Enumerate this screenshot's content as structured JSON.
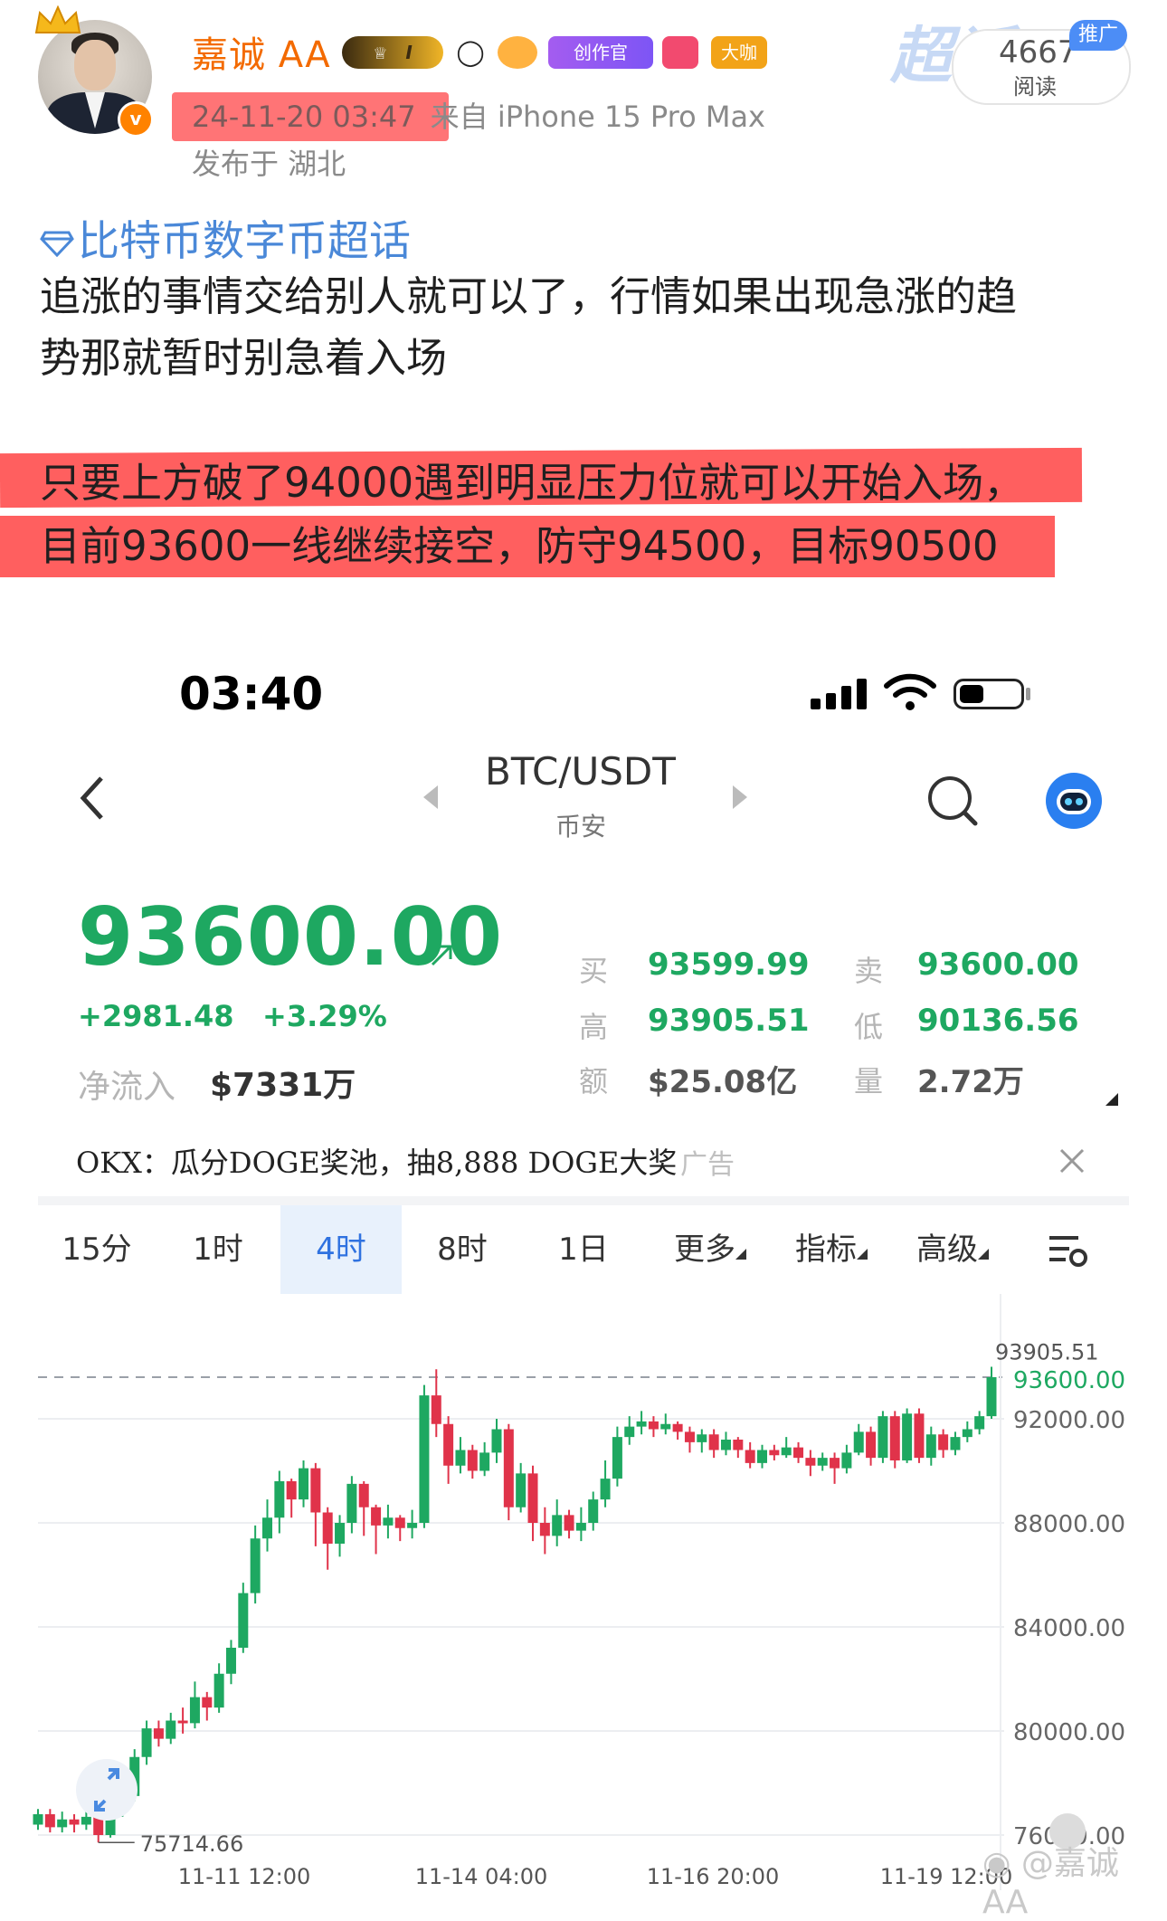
{
  "post": {
    "username": "嘉诚 AA",
    "timestamp": "24-11-20 03:47",
    "source": "来自 iPhone 15 Pro Max",
    "location": "发布于 湖北",
    "read_count": "4667",
    "read_label": "阅读",
    "promo_badge": "推广",
    "badge_creator": "创作官",
    "badge_daka": "大咖",
    "level_badge": "I",
    "verified_mark": "v",
    "super_topic_mark": "超话",
    "topic": "比特币数字币超话",
    "paragraph1_line1": "追涨的事情交给别人就可以了，行情如果出现急涨的趋",
    "paragraph1_line2": "势那就暂时别急着入场",
    "paragraph2_line1": "只要上方破了94000遇到明显压力位就可以开始入场，",
    "paragraph2_line2": "目前93600一线继续接空，防守94500，目标90500"
  },
  "screenshot": {
    "status_time": "03:40",
    "pair": "BTC/USDT",
    "exchange": "币安",
    "price": "93600.00",
    "change_abs": "+2981.48",
    "change_pct": "+3.29%",
    "netflow_label": "净流入",
    "netflow_value": "$7331万",
    "stats": {
      "buy_label": "买",
      "buy_value": "93599.99",
      "sell_label": "卖",
      "sell_value": "93600.00",
      "high_label": "高",
      "high_value": "93905.51",
      "low_label": "低",
      "low_value": "90136.56",
      "amount_label": "额",
      "amount_value": "$25.08亿",
      "volume_label": "量",
      "volume_value": "2.72万"
    },
    "ad_text": "OKX：瓜分DOGE奖池，抽8,888 DOGE大奖",
    "ad_tag": "广告",
    "tabs": [
      "15分",
      "1时",
      "4时",
      "8时",
      "1日",
      "更多",
      "指标",
      "高级"
    ],
    "active_tab": "4时"
  },
  "chart_data": {
    "type": "candlestick",
    "price_labels": [
      "93600.00",
      "92000.00",
      "88000.00",
      "84000.00",
      "80000.00",
      "76000.00"
    ],
    "current_price": 93600.0,
    "high_marker": "93905.51",
    "low_marker": "75714.66",
    "x_labels": [
      "11-11 12:00",
      "11-14 04:00",
      "11-16 20:00",
      "11-19 12:00"
    ],
    "ylim": [
      75000,
      95500
    ],
    "up_color": "#1ea861",
    "down_color": "#e0334a",
    "candles": [
      [
        76400,
        76800,
        77000,
        76200
      ],
      [
        76800,
        76300,
        77000,
        76100
      ],
      [
        76300,
        76600,
        76900,
        76100
      ],
      [
        76600,
        76400,
        76800,
        76100
      ],
      [
        76400,
        76700,
        76900,
        76200
      ],
      [
        76700,
        76000,
        76800,
        75714.66
      ],
      [
        76000,
        76900,
        77100,
        75900
      ],
      [
        76900,
        77500,
        77800,
        76700
      ],
      [
        77500,
        79000,
        79300,
        77300
      ],
      [
        79000,
        80100,
        80400,
        78700
      ],
      [
        80100,
        79700,
        80400,
        79400
      ],
      [
        79700,
        80400,
        80700,
        79500
      ],
      [
        80400,
        80300,
        80900,
        79900
      ],
      [
        80300,
        81300,
        81900,
        80100
      ],
      [
        81300,
        80900,
        81500,
        80400
      ],
      [
        80900,
        82200,
        82600,
        80700
      ],
      [
        82200,
        83200,
        83500,
        81800
      ],
      [
        83200,
        85300,
        85700,
        83000
      ],
      [
        85300,
        87400,
        87900,
        84900
      ],
      [
        87400,
        88200,
        88900,
        86900
      ],
      [
        88200,
        89600,
        90000,
        87600
      ],
      [
        89600,
        88900,
        89700,
        88200
      ],
      [
        88900,
        90100,
        90400,
        88600
      ],
      [
        90100,
        88400,
        90300,
        87100
      ],
      [
        88400,
        87200,
        88600,
        86200
      ],
      [
        87200,
        88000,
        88300,
        86700
      ],
      [
        88000,
        89500,
        89800,
        87600
      ],
      [
        89500,
        88600,
        89600,
        87500
      ],
      [
        88600,
        87900,
        88700,
        86800
      ],
      [
        87900,
        88200,
        88700,
        87400
      ],
      [
        88200,
        87800,
        88300,
        87300
      ],
      [
        87800,
        88000,
        88500,
        87400
      ],
      [
        88000,
        92900,
        93300,
        87800
      ],
      [
        92900,
        91800,
        93905.51,
        91300
      ],
      [
        91800,
        90200,
        92100,
        89500
      ],
      [
        90200,
        90800,
        91300,
        89900
      ],
      [
        90800,
        90000,
        91000,
        89700
      ],
      [
        90000,
        90700,
        91100,
        89800
      ],
      [
        90700,
        91600,
        92000,
        90300
      ],
      [
        91600,
        88600,
        91800,
        88100
      ],
      [
        88600,
        89900,
        90300,
        88400
      ],
      [
        89900,
        88000,
        90200,
        87300
      ],
      [
        88000,
        87500,
        88600,
        86800
      ],
      [
        87500,
        88300,
        88900,
        87100
      ],
      [
        88300,
        87700,
        88500,
        87400
      ],
      [
        87700,
        88000,
        88600,
        87300
      ],
      [
        88000,
        88900,
        89200,
        87700
      ],
      [
        88900,
        89700,
        90400,
        88600
      ],
      [
        89700,
        91300,
        91700,
        89400
      ],
      [
        91300,
        91700,
        92100,
        91000
      ],
      [
        91700,
        91900,
        92300,
        91400
      ],
      [
        91900,
        91600,
        92100,
        91300
      ],
      [
        91600,
        91800,
        92200,
        91400
      ],
      [
        91800,
        91500,
        91900,
        91200
      ],
      [
        91500,
        91100,
        91700,
        90700
      ],
      [
        91100,
        91400,
        91600,
        90700
      ],
      [
        91400,
        90800,
        91600,
        90500
      ],
      [
        90800,
        91200,
        91500,
        90600
      ],
      [
        91200,
        90800,
        91300,
        90500
      ],
      [
        90800,
        90300,
        91100,
        90100
      ],
      [
        90300,
        90800,
        91000,
        90100
      ],
      [
        90800,
        90600,
        91000,
        90400
      ],
      [
        90600,
        90900,
        91300,
        90500
      ],
      [
        90900,
        90500,
        91100,
        90300
      ],
      [
        90500,
        90200,
        90800,
        89800
      ],
      [
        90200,
        90500,
        90700,
        90000
      ],
      [
        90500,
        90100,
        90700,
        89500
      ],
      [
        90100,
        90700,
        91000,
        89900
      ],
      [
        90700,
        91500,
        91800,
        90600
      ],
      [
        91500,
        90500,
        91700,
        90200
      ],
      [
        90500,
        92100,
        92300,
        90300
      ],
      [
        92100,
        90400,
        92300,
        90100
      ],
      [
        90400,
        92200,
        92400,
        90300
      ],
      [
        92200,
        90500,
        92400,
        90300
      ],
      [
        90500,
        91400,
        91700,
        90200
      ],
      [
        91400,
        90800,
        91600,
        90500
      ],
      [
        90800,
        91300,
        91500,
        90600
      ],
      [
        91300,
        91600,
        91900,
        91100
      ],
      [
        91600,
        92100,
        92300,
        91400
      ],
      [
        92100,
        93600.0,
        94000,
        92000
      ]
    ]
  }
}
